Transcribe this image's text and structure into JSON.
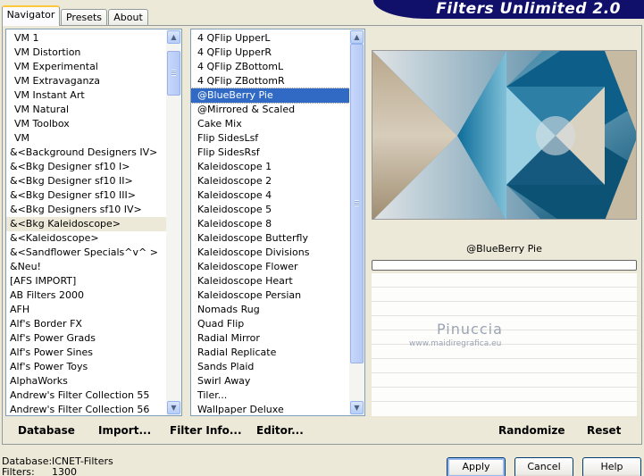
{
  "tabs": [
    "Navigator",
    "Presets",
    "About"
  ],
  "banner_title": "Filters Unlimited 2.0",
  "categories": [
    "VM 1",
    "VM Distortion",
    "VM Experimental",
    "VM Extravaganza",
    "VM Instant Art",
    "VM Natural",
    "VM Toolbox",
    "VM",
    "&<Background Designers IV>",
    "&<Bkg Designer sf10 I>",
    "&<Bkg Designer sf10 II>",
    "&<Bkg Designer sf10 III>",
    "&<Bkg Designers sf10 IV>",
    "&<Bkg Kaleidoscope>",
    "&<Kaleidoscope>",
    "&<Sandflower Specials^v^ >",
    "&Neu!",
    "[AFS IMPORT]",
    "AB Filters 2000",
    "AFH",
    "Alf's Border FX",
    "Alf's Power Grads",
    "Alf's Power Sines",
    "Alf's Power Toys",
    "AlphaWorks",
    "Andrew's Filter Collection 55",
    "Andrew's Filter Collection 56"
  ],
  "selected_category": "&<Bkg Kaleidoscope>",
  "filters": [
    "4 QFlip UpperL",
    "4 QFlip UpperR",
    "4 QFlip ZBottomL",
    "4 QFlip ZBottomR",
    "@BlueBerry Pie",
    "@Mirrored & Scaled",
    "Cake Mix",
    "Flip SidesLsf",
    "Flip SidesRsf",
    "Kaleidoscope 1",
    "Kaleidoscope 2",
    "Kaleidoscope 4",
    "Kaleidoscope 5",
    "Kaleidoscope 8",
    "Kaleidoscope Butterfly",
    "Kaleidoscope Divisions",
    "Kaleidoscope Flower",
    "Kaleidoscope Heart",
    "Kaleidoscope Persian",
    "Nomads Rug",
    "Quad Flip",
    "Radial Mirror",
    "Radial Replicate",
    "Sands Plaid",
    "Swirl Away",
    "Tiler...",
    "Wallpaper Deluxe"
  ],
  "selected_filter": "@BlueBerry Pie",
  "filter_name": "@BlueBerry Pie",
  "progress": 0,
  "watermark": {
    "name": "Pinuccia",
    "url": "www.maidiregrafica.eu"
  },
  "links": {
    "database": "Database",
    "import": "Import...",
    "filter_info": "Filter Info...",
    "editor": "Editor...",
    "randomize": "Randomize",
    "reset": "Reset"
  },
  "footer": {
    "database_label": "Database:",
    "database_value": "ICNET-Filters",
    "filters_label": "Filters:",
    "filters_value": "1300"
  },
  "buttons": {
    "apply": "Apply",
    "cancel": "Cancel",
    "help": "Help"
  },
  "colors": {
    "selection": "#316ac5",
    "banner": "#10106b",
    "face": "#ece9d8"
  }
}
